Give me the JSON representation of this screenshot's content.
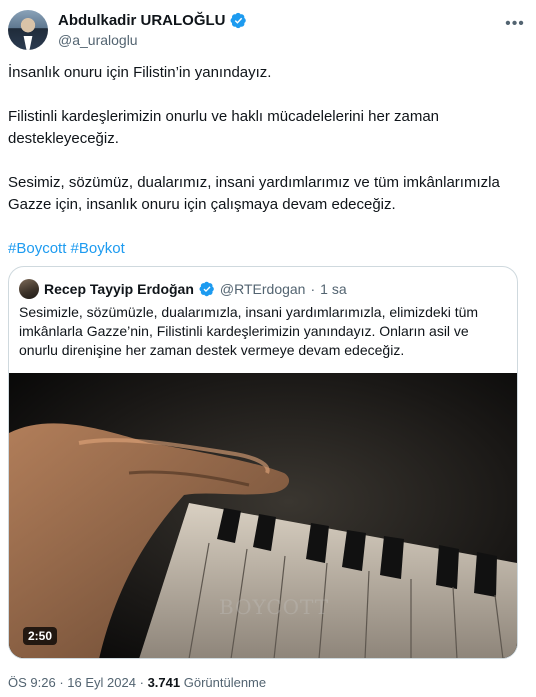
{
  "author": {
    "display_name": "Abdulkadir URALOĞLU",
    "handle": "@a_uraloglu",
    "verified_color": "#1d9bf0",
    "avatar_icon": "profile-photo"
  },
  "more_icon": "more-horizontal-icon",
  "tweet": {
    "paragraphs": [
      "İnsanlık onuru için Filistin’in yanındayız.",
      "Filistinli kardeşlerimizin onurlu ve haklı mücadelelerini her zaman destekleyeceğiz.",
      "Sesimiz, sözümüz, dualarımız, insani yardımlarımız ve tüm imkânlarımızla Gazze için, insanlık onuru için çalışmaya devam edeceğiz."
    ],
    "hashtags": [
      "#Boycott",
      "#Boykot"
    ]
  },
  "quote": {
    "display_name": "Recep Tayyip Erdoğan",
    "handle": "@RTErdogan",
    "separator": "·",
    "time": "1 sa",
    "text": "Sesimizle, sözümüzle, dualarımızla, insani yardımlarımızla, elimizdeki tüm imkânlarla Gazze’nin, Filistinli kardeşlerimizin yanındayız. Onların asil ve onurlu direnişine her zaman destek vermeye devam edeceğiz.",
    "video": {
      "duration": "2:50",
      "watermark": "BOYCOTT"
    }
  },
  "meta": {
    "time": "ÖS 9:26",
    "separator": "·",
    "date": "16 Eyl 2024",
    "views_count": "3.741",
    "views_label": "Görüntülenme"
  }
}
